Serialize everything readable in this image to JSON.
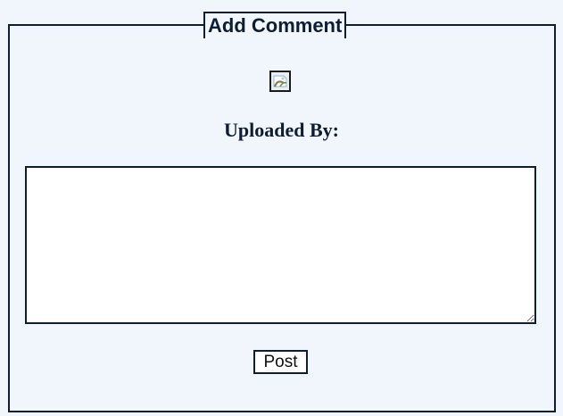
{
  "form": {
    "title": "Add Comment",
    "uploader_label": "Uploaded By:",
    "comment_value": "",
    "post_label": "Post",
    "avatar_icon": "broken-image-icon"
  },
  "colors": {
    "background": "#f0f6fc",
    "border": "#0f1d33",
    "text": "#0f1d33"
  }
}
